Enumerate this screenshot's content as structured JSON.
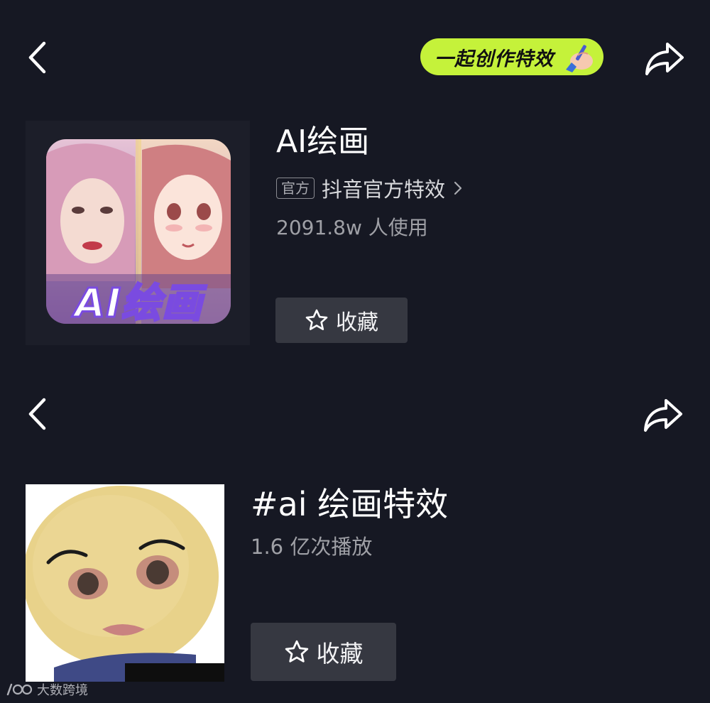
{
  "top_bar": {
    "create_button_label": "一起创作特效"
  },
  "effect": {
    "thumbnail_text": "AI绘画",
    "title": "AI绘画",
    "official_badge": "官方",
    "official_name": "抖音官方特效",
    "usage": "2091.8w 人使用",
    "favorite_label": "收藏"
  },
  "hashtag": {
    "title": "#ai 绘画特效",
    "plays": "1.6 亿次播放",
    "favorite_label": "收藏"
  },
  "watermark": {
    "text": "大数跨境"
  },
  "icons": {
    "back": "chevron-left-icon",
    "share": "share-arrow-icon",
    "star": "star-outline-icon",
    "chevron": "chevron-right-icon"
  },
  "colors": {
    "background": "#161823",
    "create_pill": "#c5f23a",
    "button": "#363841",
    "secondary_text": "#9fa0a6"
  }
}
